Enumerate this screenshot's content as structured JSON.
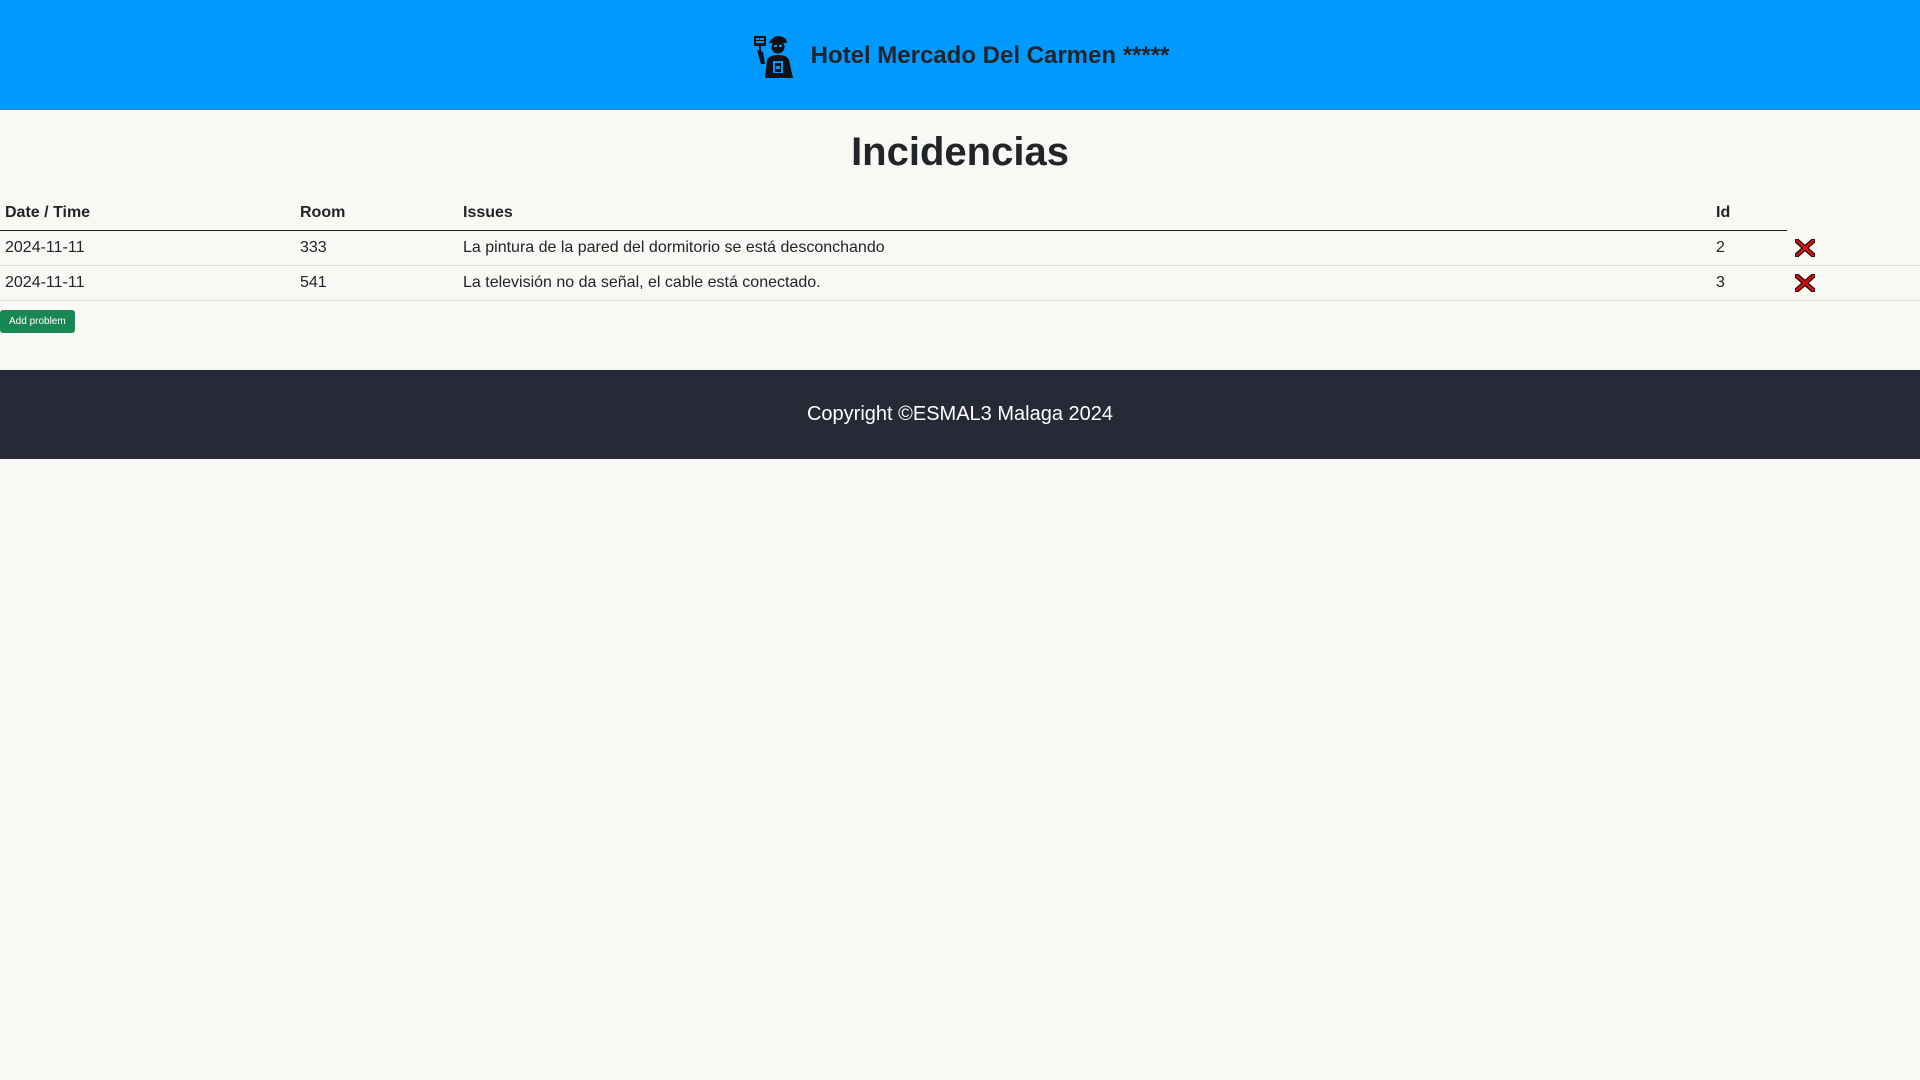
{
  "header": {
    "title": "Hotel Mercado Del Carmen *****",
    "logo_icon": "repairman-icon"
  },
  "page": {
    "title": "Incidencias"
  },
  "table": {
    "columns": [
      "Date / Time",
      "Room",
      "Issues",
      "Id"
    ],
    "rows": [
      {
        "date": "2024-11-11",
        "room": "333",
        "issue": "La pintura de la pared del dormitorio se está desconchando",
        "id": "2"
      },
      {
        "date": "2024-11-11",
        "room": "541",
        "issue": "La televisión no da señal, el cable está conectado.",
        "id": "3"
      }
    ],
    "delete_icon": "delete-x-icon"
  },
  "actions": {
    "add_label": "Add problem"
  },
  "footer": {
    "copyright": "Copyright ©ESMAL3 Malaga 2024"
  },
  "colors": {
    "header_bg": "#0099ff",
    "footer_bg": "#272a36",
    "add_button": "#198754",
    "delete_icon": "#cc1111"
  }
}
